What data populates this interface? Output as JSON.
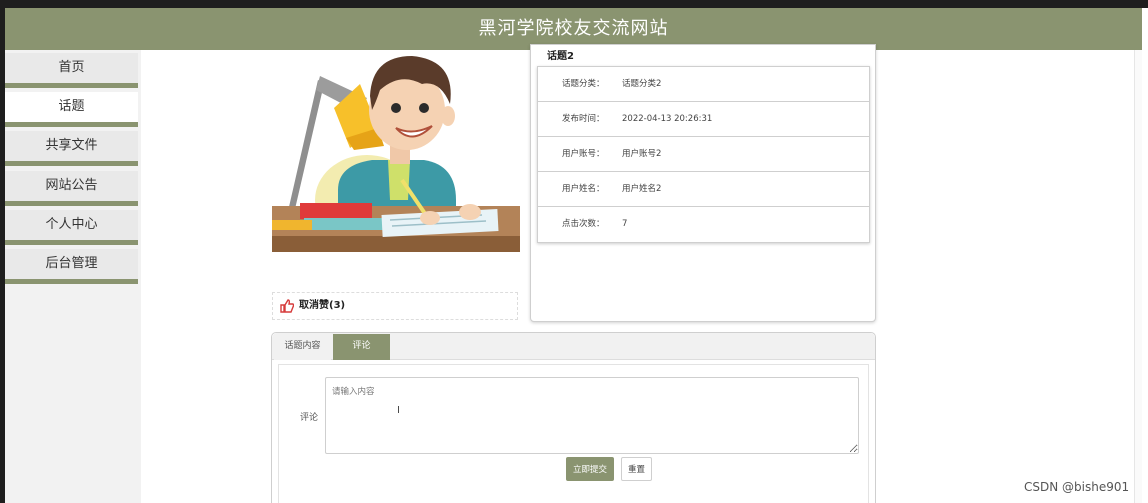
{
  "header": {
    "title": "黑河学院校友交流网站"
  },
  "sidebar": {
    "items": [
      {
        "label": "首页",
        "active": false
      },
      {
        "label": "话题",
        "active": true
      },
      {
        "label": "共享文件",
        "active": false
      },
      {
        "label": "网站公告",
        "active": false
      },
      {
        "label": "个人中心",
        "active": false
      },
      {
        "label": "后台管理",
        "active": false
      }
    ]
  },
  "like": {
    "label": "取消赞(3)"
  },
  "info": {
    "title": "话题2",
    "rows": [
      {
        "label": "话题分类：",
        "value": "话题分类2"
      },
      {
        "label": "发布时间：",
        "value": "2022-04-13 20:26:31"
      },
      {
        "label": "用户账号：",
        "value": "用户账号2"
      },
      {
        "label": "用户姓名：",
        "value": "用户姓名2"
      },
      {
        "label": "点击次数：",
        "value": "7"
      }
    ]
  },
  "tabs": [
    {
      "label": "话题内容",
      "active": false
    },
    {
      "label": "评论",
      "active": true
    }
  ],
  "comment_form": {
    "label": "评论",
    "placeholder": "请输入内容",
    "value": "",
    "submit_label": "立即提交",
    "reset_label": "重置"
  },
  "watermark": "CSDN @bishe901",
  "colors": {
    "accent": "#8a9470",
    "nav_bg": "#e9e9e9"
  }
}
